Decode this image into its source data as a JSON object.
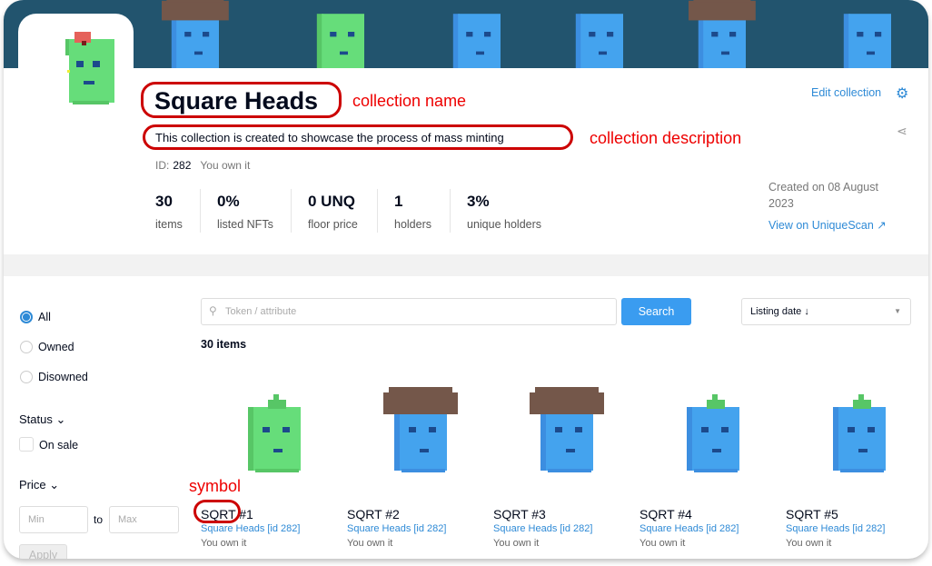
{
  "collection": {
    "name": "Square Heads",
    "description": "This collection is created to showcase the process of mass minting",
    "id_label": "ID:",
    "id": "282",
    "ownership": "You own it",
    "edit_label": "Edit collection",
    "created": "Created on 08 August 2023",
    "view_link": "View on UniqueScan ↗"
  },
  "annotations": {
    "name": "collection name",
    "description": "collection description",
    "symbol": "symbol"
  },
  "stats": [
    {
      "value": "30",
      "label": "items"
    },
    {
      "value": "0%",
      "label": "listed NFTs"
    },
    {
      "value": "0 UNQ",
      "label": "floor price"
    },
    {
      "value": "1",
      "label": "holders"
    },
    {
      "value": "3%",
      "label": "unique holders"
    }
  ],
  "filters": {
    "ownership": [
      "All",
      "Owned",
      "Disowned"
    ],
    "selected": "All",
    "status_label": "Status",
    "on_sale": "On sale",
    "price_label": "Price",
    "min_placeholder": "Min",
    "max_placeholder": "Max",
    "to": "to",
    "apply": "Apply"
  },
  "search": {
    "placeholder": "Token / attribute",
    "button": "Search",
    "sort": "Listing date ↓"
  },
  "items_count": "30 items",
  "tokens": [
    {
      "name": "SQRT #1",
      "collection": "Square Heads [id 282]",
      "owner": "You own it",
      "color": "#66dd7a",
      "hair": "sprout-green"
    },
    {
      "name": "SQRT #2",
      "collection": "Square Heads [id 282]",
      "owner": "You own it",
      "color": "#44a3ee",
      "hair": "brown"
    },
    {
      "name": "SQRT #3",
      "collection": "Square Heads [id 282]",
      "owner": "You own it",
      "color": "#44a3ee",
      "hair": "brown"
    },
    {
      "name": "SQRT #4",
      "collection": "Square Heads [id 282]",
      "owner": "You own it",
      "color": "#44a3ee",
      "hair": "sprout-green"
    },
    {
      "name": "SQRT #5",
      "collection": "Square Heads [id 282]",
      "owner": "You own it",
      "color": "#44a3ee",
      "hair": "sprout-green"
    }
  ],
  "colors": {
    "banner": "#22546e",
    "accent": "#2e8ad6",
    "annotation": "#dd0000"
  }
}
